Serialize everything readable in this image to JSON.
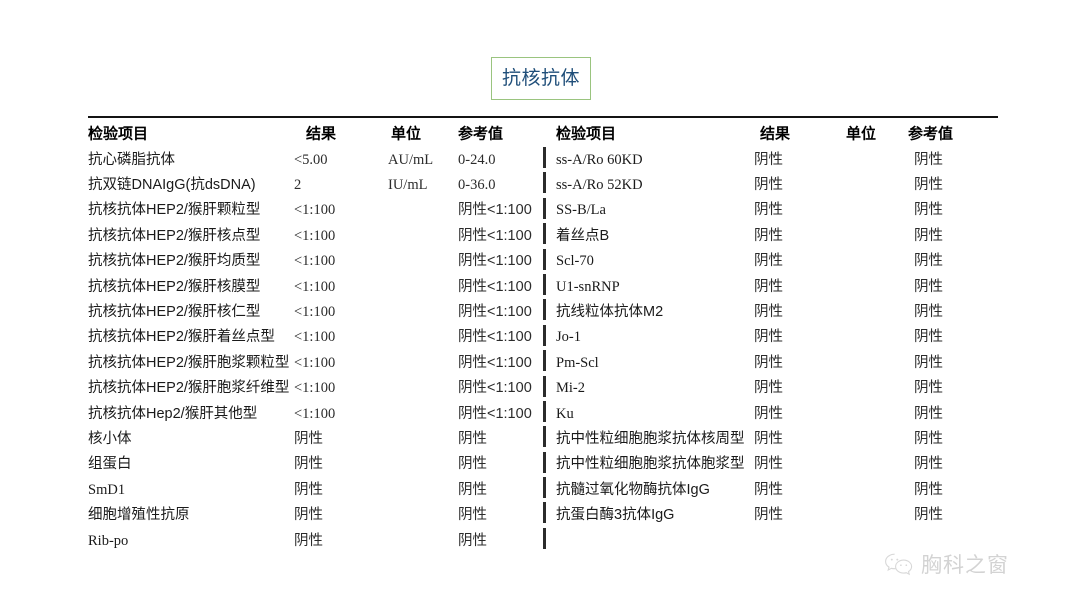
{
  "title": {
    "label": "抗核抗体",
    "border_color": "#9ac47f",
    "text_color": "#1f4e79"
  },
  "table_headers": {
    "item": "检验项目",
    "result": "结果",
    "unit": "单位",
    "reference": "参考值"
  },
  "left_table": {
    "rows": [
      {
        "item": "抗心磷脂抗体",
        "result": "<5.00",
        "unit": "AU/mL",
        "reference": "0-24.0"
      },
      {
        "item": "抗双链DNAIgG(抗dsDNA)",
        "result": "2",
        "unit": "IU/mL",
        "reference": "0-36.0"
      },
      {
        "item": "抗核抗体HEP2/猴肝颗粒型",
        "result": "<1:100",
        "unit": "",
        "reference": "阴性<1:100"
      },
      {
        "item": "抗核抗体HEP2/猴肝核点型",
        "result": "<1:100",
        "unit": "",
        "reference": "阴性<1:100"
      },
      {
        "item": "抗核抗体HEP2/猴肝均质型",
        "result": "<1:100",
        "unit": "",
        "reference": "阴性<1:100"
      },
      {
        "item": "抗核抗体HEP2/猴肝核膜型",
        "result": "<1:100",
        "unit": "",
        "reference": "阴性<1:100"
      },
      {
        "item": "抗核抗体HEP2/猴肝核仁型",
        "result": "<1:100",
        "unit": "",
        "reference": "阴性<1:100"
      },
      {
        "item": "抗核抗体HEP2/猴肝着丝点型",
        "result": "<1:100",
        "unit": "",
        "reference": "阴性<1:100"
      },
      {
        "item": "抗核抗体HEP2/猴肝胞浆颗粒型",
        "result": "<1:100",
        "unit": "",
        "reference": "阴性<1:100"
      },
      {
        "item": "抗核抗体HEP2/猴肝胞浆纤维型",
        "result": "<1:100",
        "unit": "",
        "reference": "阴性<1:100"
      },
      {
        "item": "抗核抗体Hep2/猴肝其他型",
        "result": "<1:100",
        "unit": "",
        "reference": "阴性<1:100"
      },
      {
        "item": "核小体",
        "result": "阴性",
        "unit": "",
        "reference": "阴性"
      },
      {
        "item": "组蛋白",
        "result": "阴性",
        "unit": "",
        "reference": "阴性"
      },
      {
        "item": "SmD1",
        "result": "阴性",
        "unit": "",
        "reference": "阴性"
      },
      {
        "item": "细胞增殖性抗原",
        "result": "阴性",
        "unit": "",
        "reference": "阴性"
      },
      {
        "item": "Rib-po",
        "result": "阴性",
        "unit": "",
        "reference": "阴性"
      }
    ]
  },
  "right_table": {
    "rows": [
      {
        "item": "ss-A/Ro 60KD",
        "result": "阴性",
        "unit": "",
        "reference": "阴性"
      },
      {
        "item": "ss-A/Ro 52KD",
        "result": "阴性",
        "unit": "",
        "reference": "阴性"
      },
      {
        "item": "SS-B/La",
        "result": "阴性",
        "unit": "",
        "reference": "阴性"
      },
      {
        "item": "着丝点B",
        "result": "阴性",
        "unit": "",
        "reference": "阴性"
      },
      {
        "item": "Scl-70",
        "result": "阴性",
        "unit": "",
        "reference": "阴性"
      },
      {
        "item": "U1-snRNP",
        "result": "阴性",
        "unit": "",
        "reference": "阴性"
      },
      {
        "item": "抗线粒体抗体M2",
        "result": "阴性",
        "unit": "",
        "reference": "阴性"
      },
      {
        "item": "Jo-1",
        "result": "阴性",
        "unit": "",
        "reference": "阴性"
      },
      {
        "item": "Pm-Scl",
        "result": "阴性",
        "unit": "",
        "reference": "阴性"
      },
      {
        "item": "Mi-2",
        "result": "阴性",
        "unit": "",
        "reference": "阴性"
      },
      {
        "item": "Ku",
        "result": "阴性",
        "unit": "",
        "reference": "阴性"
      },
      {
        "item": "抗中性粒细胞胞浆抗体核周型",
        "result": "阴性",
        "unit": "",
        "reference": "阴性"
      },
      {
        "item": "抗中性粒细胞胞浆抗体胞浆型",
        "result": "阴性",
        "unit": "",
        "reference": "阴性"
      },
      {
        "item": "抗髓过氧化物酶抗体IgG",
        "result": "阴性",
        "unit": "",
        "reference": "阴性"
      },
      {
        "item": "抗蛋白酶3抗体IgG",
        "result": "阴性",
        "unit": "",
        "reference": "阴性"
      }
    ]
  },
  "watermark": {
    "text": "胸科之窗",
    "icon": "wechat-icon",
    "color": "#8d8d8d"
  }
}
